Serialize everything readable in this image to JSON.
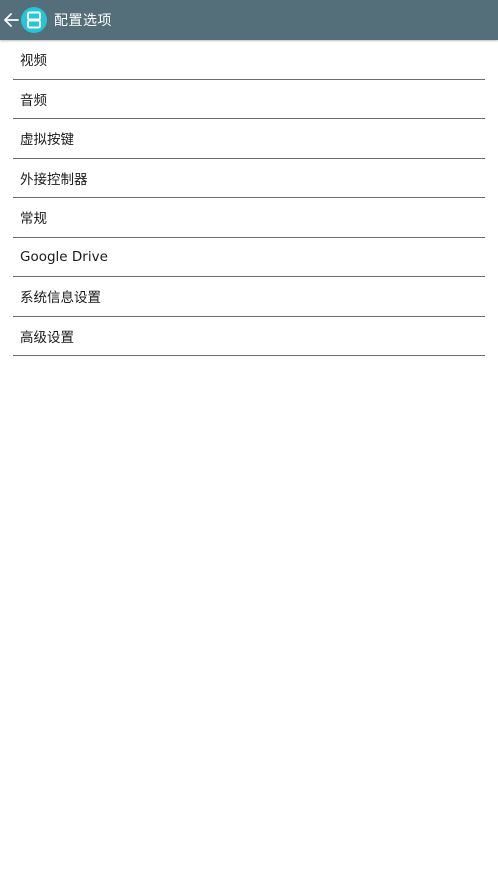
{
  "toolbar": {
    "title": "配置选项",
    "back_icon": "arrow-left-icon",
    "logo_icon": "app-logo-icon",
    "background": "#546e7a",
    "logo_color": "#26c6da"
  },
  "menu": {
    "items": [
      {
        "label": "视频"
      },
      {
        "label": "音频"
      },
      {
        "label": "虚拟按键"
      },
      {
        "label": "外接控制器"
      },
      {
        "label": "常规"
      },
      {
        "label": "Google Drive"
      },
      {
        "label": "系统信息设置"
      },
      {
        "label": "高级设置"
      }
    ]
  }
}
